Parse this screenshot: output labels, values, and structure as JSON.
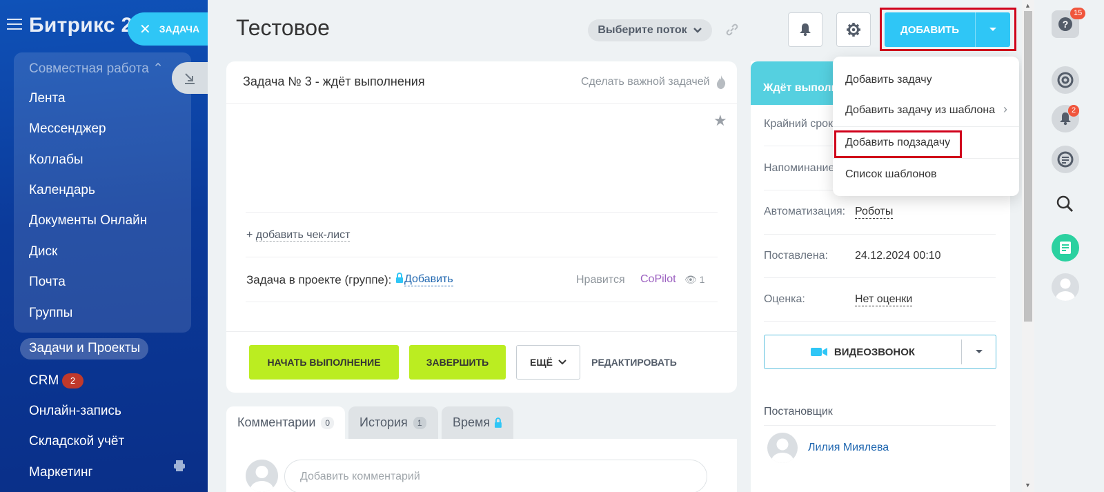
{
  "sidebar": {
    "brand": "Битрикс 2",
    "task_button": "ЗАДАЧА",
    "group_header": "Совместная работа",
    "items": [
      {
        "label": "Лента"
      },
      {
        "label": "Мессенджер"
      },
      {
        "label": "Коллабы"
      },
      {
        "label": "Календарь"
      },
      {
        "label": "Документы Онлайн"
      },
      {
        "label": "Диск"
      },
      {
        "label": "Почта"
      },
      {
        "label": "Группы"
      },
      {
        "label": "Задачи и Проекты"
      },
      {
        "label": "CRM"
      },
      {
        "label": "Онлайн-запись"
      },
      {
        "label": "Складской учёт"
      },
      {
        "label": "Маркетинг"
      }
    ],
    "crm_badge": "2"
  },
  "header": {
    "title": "Тестовое",
    "flow_select": "Выберите поток",
    "add_button": "ДОБАВИТЬ"
  },
  "dropdown": {
    "items": [
      "Добавить задачу",
      "Добавить задачу из шаблона",
      "Добавить подзадачу",
      "Список шаблонов"
    ]
  },
  "task": {
    "header": "Задача № 3 - ждёт выполнения",
    "make_important": "Сделать важной задачей",
    "add_checklist": "добавить чек-лист",
    "project_label": "Задача в проекте (группе):",
    "project_add": "Добавить",
    "likes": "Нравится",
    "copilot": "CoPilot",
    "views": "1",
    "buttons": {
      "start": "НАЧАТЬ ВЫПОЛНЕНИЕ",
      "finish": "ЗАВЕРШИТЬ",
      "more": "ЕЩЁ",
      "edit": "РЕДАКТИРОВАТЬ"
    }
  },
  "tabs": [
    {
      "label": "Комментарии",
      "count": "0"
    },
    {
      "label": "История",
      "count": "1"
    },
    {
      "label": "Время"
    }
  ],
  "comment_placeholder": "Добавить комментарий",
  "side": {
    "status": "Ждёт выполн",
    "deadline_label": "Крайний срок",
    "reminder_label": "Напоминание",
    "automation_label": "Автоматизация:",
    "automation_value": "Роботы",
    "created_label": "Поставлена:",
    "created_value": "24.12.2024 00:10",
    "rating_label": "Оценка:",
    "rating_value": "Нет оценки",
    "video_call": "ВИДЕОЗВОНОК",
    "creator_label": "Постановщик",
    "creator_name": "Лилия Миялева"
  },
  "rightbar": {
    "help_badge": "15",
    "notif_badge": "2"
  },
  "colors": {
    "accent": "#2fc6f6",
    "green_button": "#bbed21",
    "highlight": "#d0021b",
    "status": "#55d0e0"
  }
}
